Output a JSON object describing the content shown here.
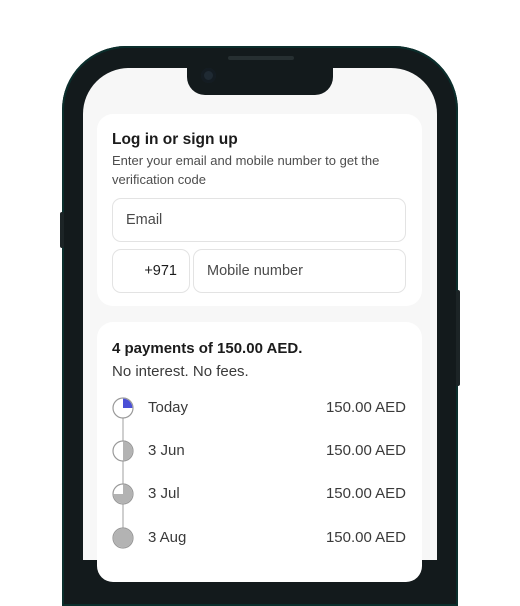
{
  "login": {
    "title": "Log in or sign up",
    "subtitle": "Enter your email and mobile number to get the verification code",
    "email_placeholder": "Email",
    "country_code": "+971",
    "mobile_placeholder": "Mobile number"
  },
  "payments": {
    "title": "4 payments of 150.00 AED.",
    "subtitle": "No interest. No fees.",
    "schedule": [
      {
        "label": "Today",
        "amount": "150.00 AED",
        "paid_fraction": 0.25,
        "icon": "quarter-pie-icon",
        "color": "#4a4fd6"
      },
      {
        "label": "3 Jun",
        "amount": "150.00 AED",
        "paid_fraction": 0.5,
        "icon": "half-pie-icon",
        "color": "#b3b3b3"
      },
      {
        "label": "3 Jul",
        "amount": "150.00 AED",
        "paid_fraction": 0.75,
        "icon": "three-quarter-pie-icon",
        "color": "#b3b3b3"
      },
      {
        "label": "3 Aug",
        "amount": "150.00 AED",
        "paid_fraction": 1.0,
        "icon": "full-pie-icon",
        "color": "#b3b3b3"
      }
    ]
  }
}
